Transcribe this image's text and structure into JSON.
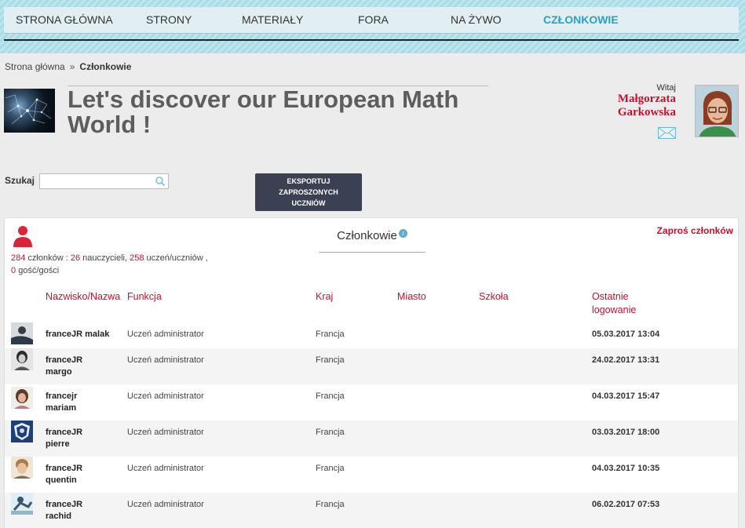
{
  "nav": {
    "items": [
      {
        "label": "STRONA GŁÓWNA"
      },
      {
        "label": "STRONY"
      },
      {
        "label": "MATERIAŁY"
      },
      {
        "label": "FORA"
      },
      {
        "label": "NA ŻYWO"
      },
      {
        "label": "CZŁONKOWIE"
      }
    ],
    "active_index": 5
  },
  "breadcrumb": {
    "home": "Strona główna",
    "separator": "»",
    "current": "Członkowie"
  },
  "header": {
    "project_title": "Let's discover our European Math World !",
    "welcome_label": "Witaj",
    "user_first": "Małgorzata",
    "user_last": "Garkowska"
  },
  "search": {
    "label": "Szukaj",
    "value": "",
    "placeholder": ""
  },
  "export_button": {
    "line1": "EKSPORTUJ",
    "line2": "ZAPROSZONYCH",
    "line3": "UCZNIÓW"
  },
  "members": {
    "title": "Członkowie",
    "info_symbol": "i",
    "invite_label": "Zaproś członków",
    "stats": {
      "total": "284",
      "total_label": "członków :",
      "teachers": "26",
      "teachers_label": "nauczycieli,",
      "students": "258",
      "students_label": "uczeń/uczniów ,",
      "guests": "0",
      "guests_label": "gość/gości"
    },
    "columns": {
      "name": "Nazwisko/Nazwa",
      "role": "Funkcja",
      "country": "Kraj",
      "city": "Miasto",
      "school": "Szkoła",
      "last_login_1": "Ostatnie",
      "last_login_2": "logowanie"
    },
    "rows": [
      {
        "name_1": "franceJR malak",
        "name_2": "",
        "role": "Uczeń administrator",
        "country": "Francja",
        "last_login": "05.03.2017 13:04"
      },
      {
        "name_1": "franceJR",
        "name_2": "margo",
        "role": "Uczeń administrator",
        "country": "Francja",
        "last_login": "24.02.2017 13:31"
      },
      {
        "name_1": "francejr",
        "name_2": "mariam",
        "role": "Uczeń administrator",
        "country": "Francja",
        "last_login": "04.03.2017 15:47"
      },
      {
        "name_1": "franceJR",
        "name_2": "pierre",
        "role": "Uczeń administrator",
        "country": "Francja",
        "last_login": "03.03.2017 18:00"
      },
      {
        "name_1": "franceJR",
        "name_2": "quentin",
        "role": "Uczeń administrator",
        "country": "Francja",
        "last_login": "04.03.2017 10:35"
      },
      {
        "name_1": "franceJR",
        "name_2": "rachid",
        "role": "Uczeń administrator",
        "country": "Francja",
        "last_login": "06.02.2017 07:53"
      }
    ]
  },
  "colors": {
    "accent_red": "#c8102e",
    "nav_active": "#2aa0c6",
    "button_dark": "#3b4152"
  }
}
